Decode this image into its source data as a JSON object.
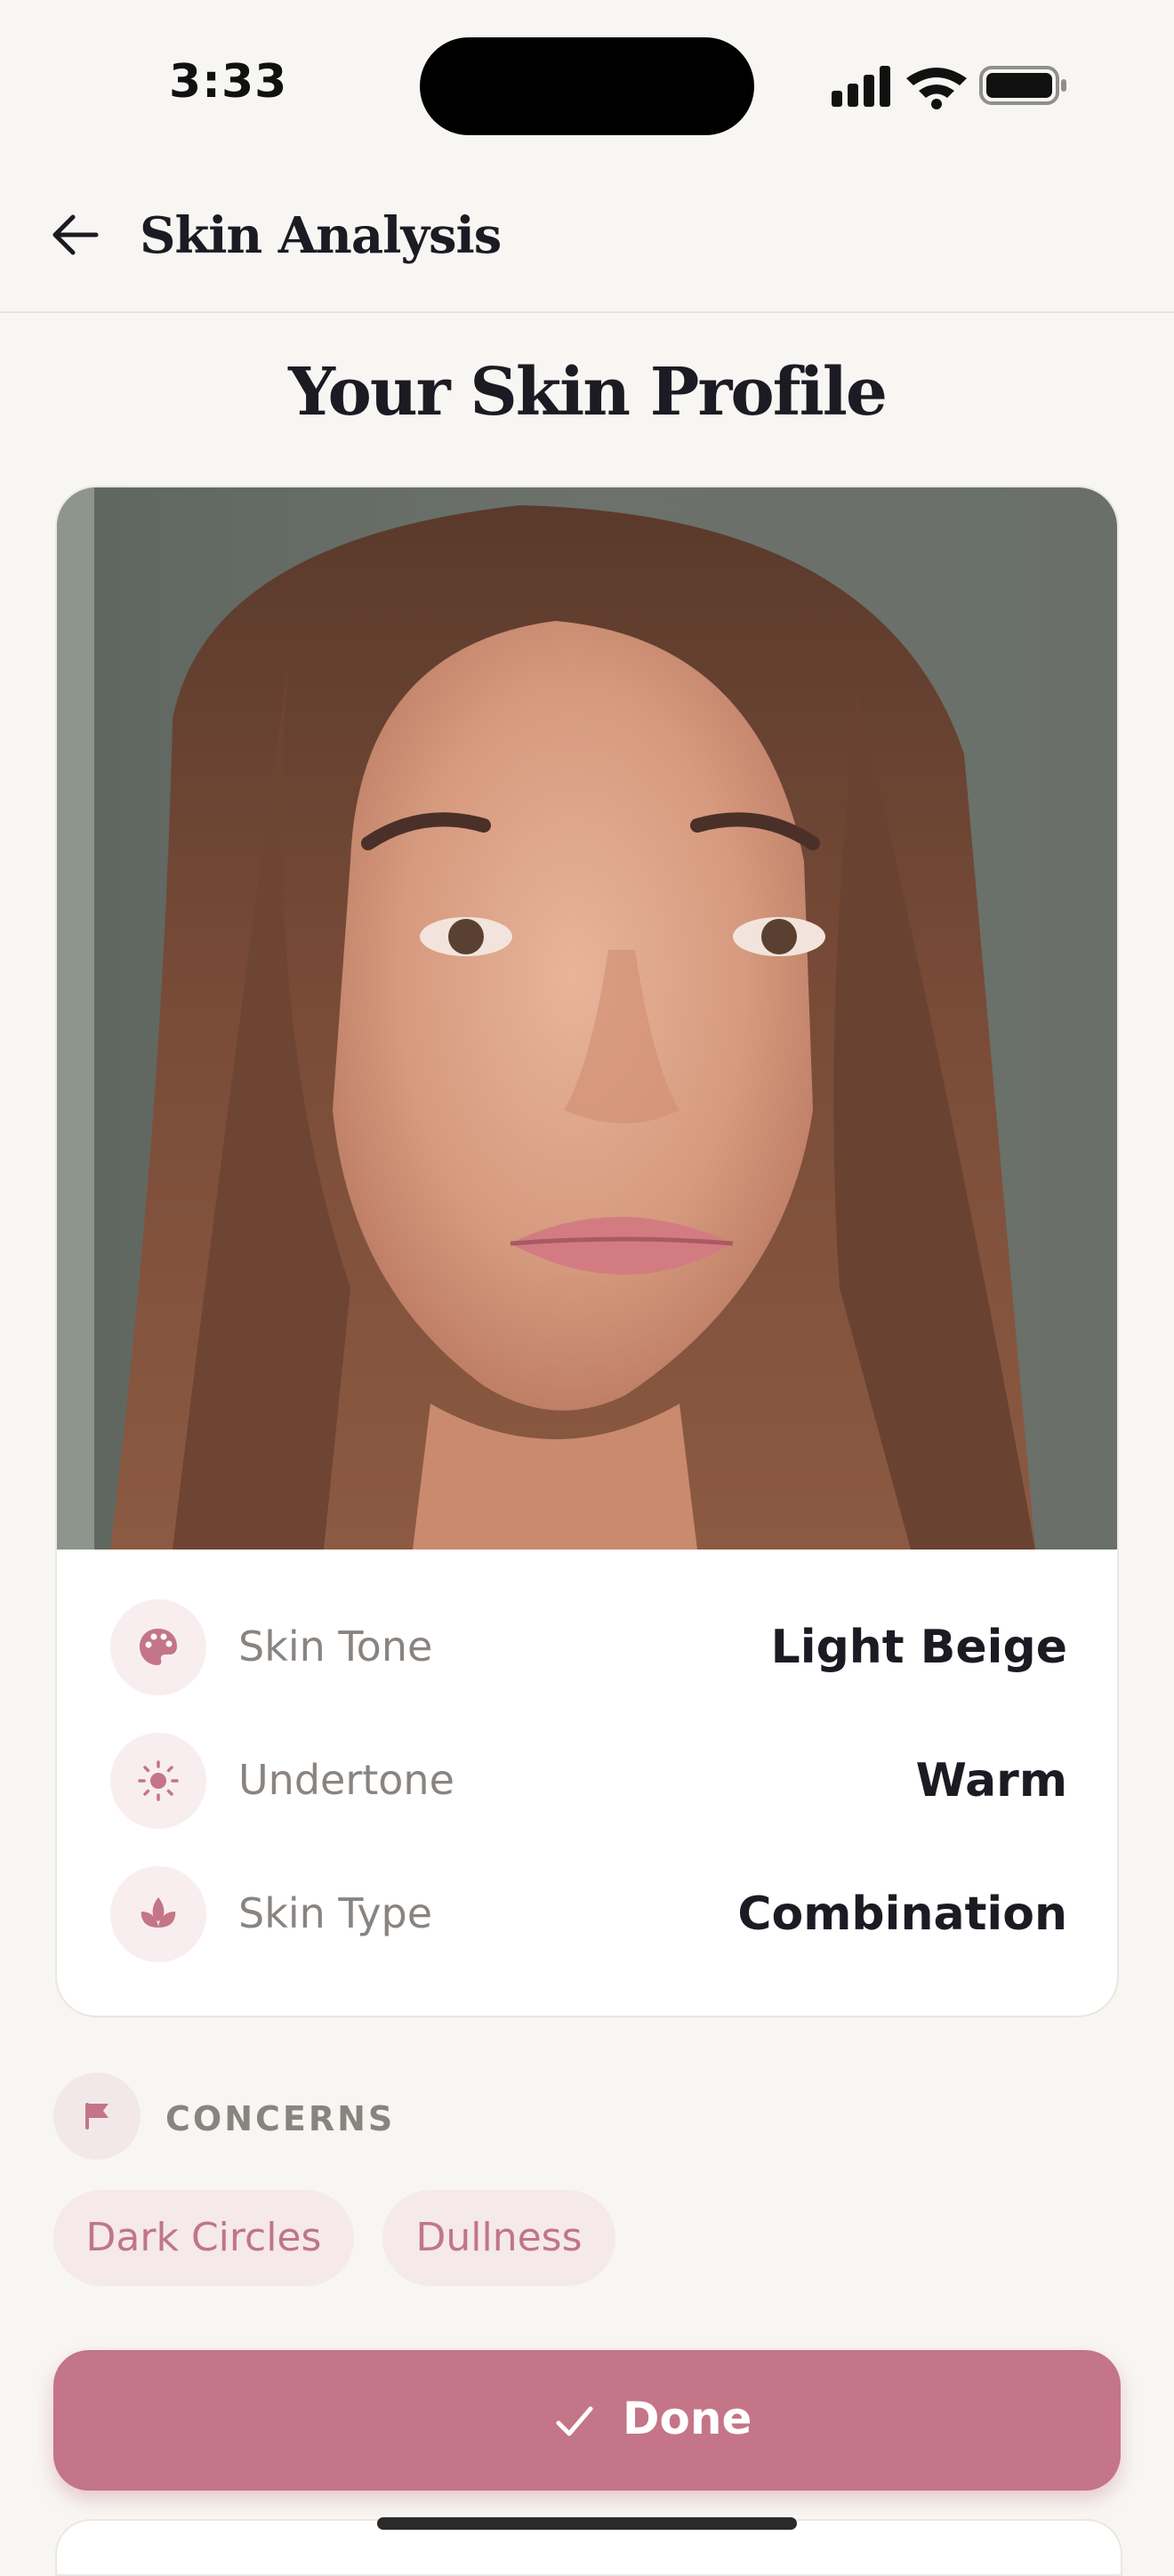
{
  "status_bar": {
    "time": "3:33"
  },
  "nav": {
    "title": "Skin Analysis"
  },
  "heading": "Your Skin Profile",
  "profile": {
    "rows": [
      {
        "icon": "palette-icon",
        "label": "Skin Tone",
        "value": "Light Beige"
      },
      {
        "icon": "sun-icon",
        "label": "Undertone",
        "value": "Warm"
      },
      {
        "icon": "lotus-icon",
        "label": "Skin Type",
        "value": "Combination"
      }
    ]
  },
  "concerns": {
    "label": "CONCERNS",
    "icon": "flag-icon",
    "chips": [
      "Dark Circles",
      "Dullness"
    ]
  },
  "done_button": {
    "label": "Done",
    "icon": "check-icon"
  },
  "colors": {
    "accent": "#c47587",
    "background": "#f8f6f3",
    "chip_bg": "#f5e9ea",
    "chip_text": "#c07688"
  }
}
